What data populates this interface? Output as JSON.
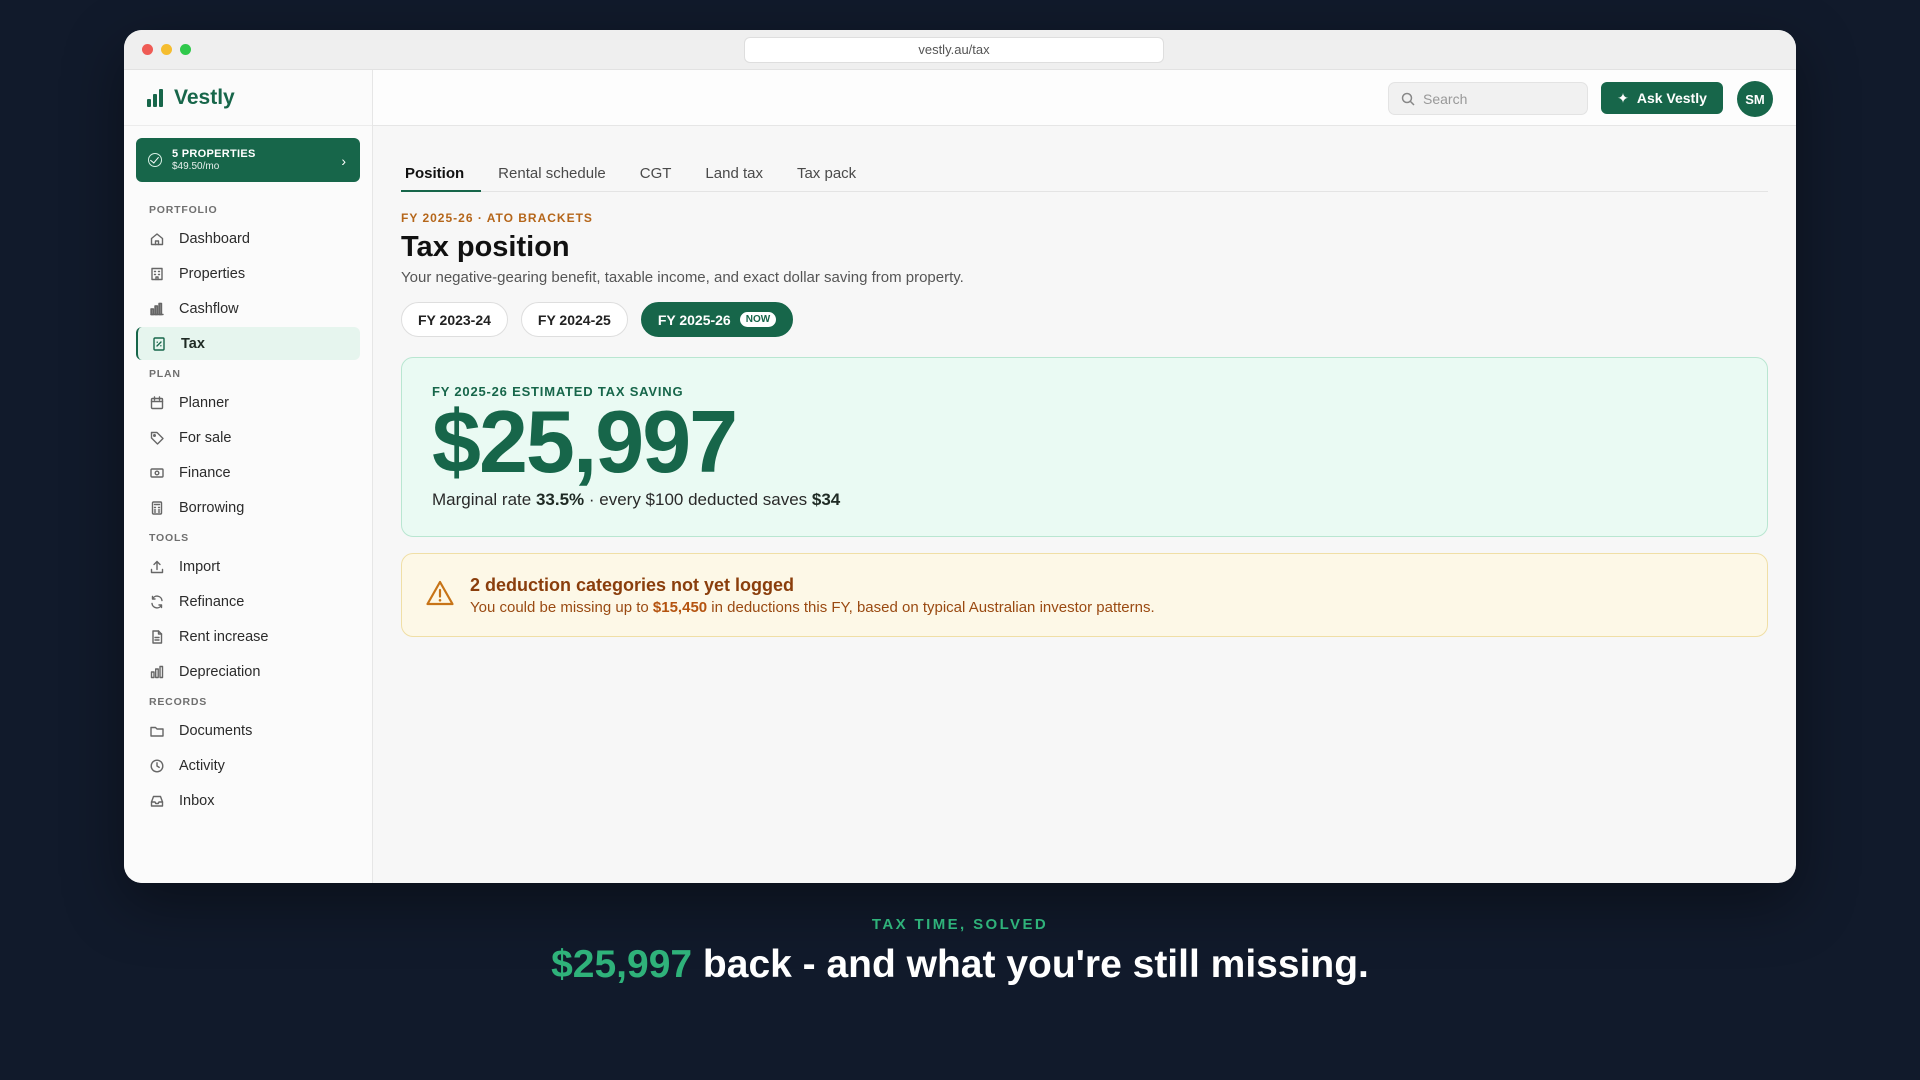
{
  "browser": {
    "url": "vestly.au/tax"
  },
  "brand": {
    "name": "Vestly"
  },
  "plan": {
    "title": "5 PROPERTIES",
    "price": "$49.50/mo"
  },
  "sidebar": {
    "sections": [
      {
        "label": "PORTFOLIO",
        "items": [
          "Dashboard",
          "Properties",
          "Cashflow",
          "Tax"
        ]
      },
      {
        "label": "PLAN",
        "items": [
          "Planner",
          "For sale",
          "Finance",
          "Borrowing"
        ]
      },
      {
        "label": "TOOLS",
        "items": [
          "Import",
          "Refinance",
          "Rent increase",
          "Depreciation"
        ]
      },
      {
        "label": "RECORDS",
        "items": [
          "Documents",
          "Activity",
          "Inbox"
        ]
      }
    ],
    "active": "Tax"
  },
  "topbar": {
    "search_placeholder": "Search",
    "ask_label": "Ask Vestly",
    "avatar_initials": "SM"
  },
  "tabs": [
    "Position",
    "Rental schedule",
    "CGT",
    "Land tax",
    "Tax pack"
  ],
  "active_tab": "Position",
  "header": {
    "eyebrow": "FY 2025-26 · ATO BRACKETS",
    "title": "Tax position",
    "subtitle": "Your negative-gearing benefit, taxable income, and exact dollar saving from property."
  },
  "fy_pills": [
    {
      "label": "FY 2023-24",
      "active": false
    },
    {
      "label": "FY 2024-25",
      "active": false
    },
    {
      "label": "FY 2025-26",
      "active": true,
      "badge": "NOW"
    }
  ],
  "saving": {
    "eyebrow": "FY 2025-26 ESTIMATED TAX SAVING",
    "amount": "$25,997",
    "line_prefix": "Marginal rate ",
    "rate": "33.5%",
    "line_mid": " · every $100 deducted saves ",
    "saves": "$34"
  },
  "warning": {
    "title": "2 deduction categories not yet logged",
    "text_prefix": "You could be missing up to ",
    "amount": "$15,450",
    "text_suffix": " in deductions this FY, based on typical Australian investor patterns."
  },
  "caption": {
    "eyebrow": "TAX TIME, SOLVED",
    "accent": "$25,997",
    "rest": " back - and what you're still missing."
  },
  "colors": {
    "brand": "#17664a",
    "accent": "#2fb27a",
    "warning": "#8a3e0c",
    "background": "#111a2b"
  }
}
